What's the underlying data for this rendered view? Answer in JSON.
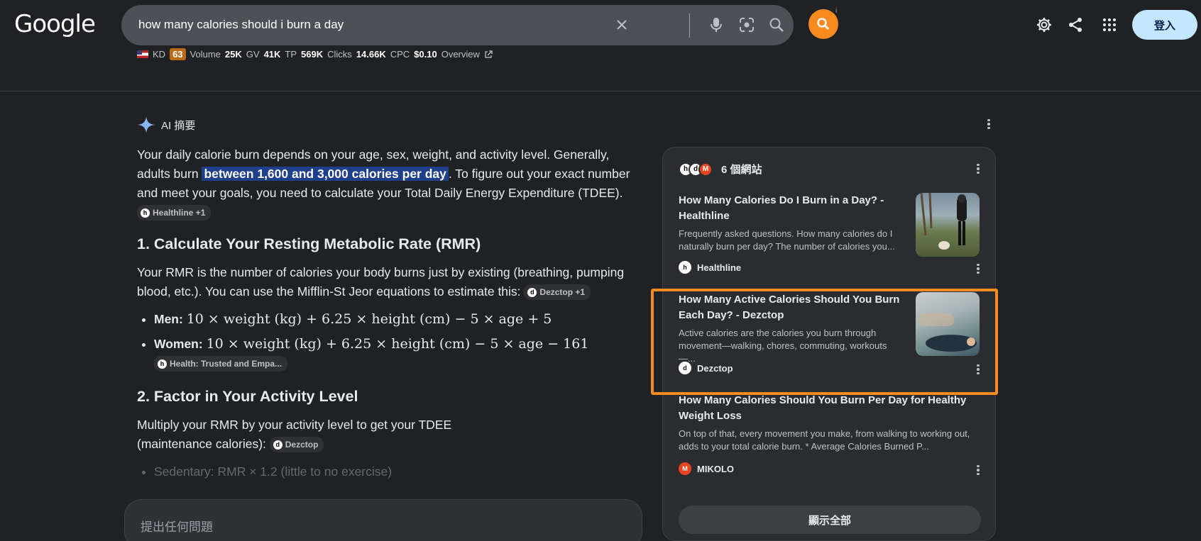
{
  "header": {
    "logo": "Google",
    "search_query": "how many calories should i burn a day",
    "login_label": "登入",
    "info_mark": "i"
  },
  "seo": {
    "kd_label": "KD",
    "kd_value": "63",
    "volume_label": "Volume",
    "volume_value": "25K",
    "gv_label": "GV",
    "gv_value": "41K",
    "tp_label": "TP",
    "tp_value": "569K",
    "clicks_label": "Clicks",
    "clicks_value": "14.66K",
    "cpc_label": "CPC",
    "cpc_value": "$0.10",
    "overview_label": "Overview"
  },
  "ai": {
    "heading": "AI 摘要",
    "intro_1": "Your daily calorie burn depends on your age, sex, weight, and activity level. Generally, adults burn ",
    "intro_hl": "between 1,600 and 3,000 calories per day",
    "intro_2": ". To figure out your exact number and meet your goals, you need to calculate your Total Daily Energy Expenditure (TDEE).",
    "intro_chip": "Healthline +1",
    "sec1_title": "1. Calculate Your Resting Metabolic Rate (RMR)",
    "sec1_text": "Your RMR is the number of calories your body burns just by existing (breathing, pumping blood, etc.). You can use the Mifflin-St Jeor equations to estimate this:",
    "sec1_chip": "Dezctop +1",
    "men_label": "Men:",
    "men_formula": "10 × weight (kg) + 6.25 × height (cm) − 5 × age + 5",
    "women_label": "Women:",
    "women_formula": "10 × weight (kg) + 6.25 × height (cm) − 5 × age − 161",
    "women_chip": "Health: Trusted and Empa...",
    "sec2_title": "2. Factor in Your Activity Level",
    "sec2_text": "Multiply your RMR by your activity level to get your TDEE (maintenance calories):",
    "sec2_chip": "Dezctop",
    "faded_bullet": "Sedentary: RMR × 1.2 (little to no exercise)"
  },
  "ask": {
    "placeholder": "提出任何問題"
  },
  "sources": {
    "count_label": "6 個網站",
    "items": [
      {
        "title": "How Many Calories Do I Burn in a Day? - Healthline",
        "desc": "Frequently asked questions. How many calories do I naturally burn per day? The number of calories you...",
        "source": "Healthline"
      },
      {
        "title": "How Many Active Calories Should You Burn Each Day? - Dezctop",
        "desc": "Active calories are the calories you burn through movement—walking, chores, commuting, workouts—...",
        "source": "Dezctop"
      },
      {
        "title": "How Many Calories Should You Burn Per Day for Healthy Weight Loss",
        "desc": "On top of that, every movement you make, from walking to working out, adds to your total calorie burn. * Average Calories Burned P...",
        "source": "MIKOLO"
      }
    ],
    "show_all_label": "顯示全部"
  },
  "colors": {
    "accent_orange": "#f78b1d",
    "highlight_blue": "#1f3f8c",
    "login_bg": "#c2e7ff"
  }
}
